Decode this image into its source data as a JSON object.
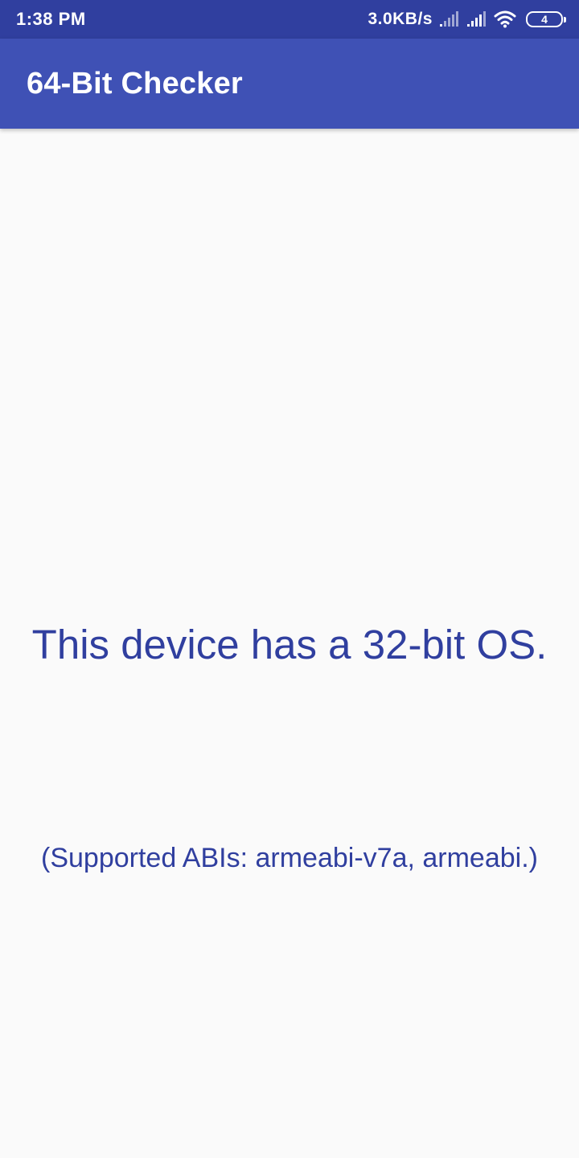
{
  "status_bar": {
    "time": "1:38 PM",
    "net_speed": "3.0KB/s",
    "battery_level": "4",
    "icons": [
      "signal-icon",
      "signal-icon",
      "wifi-icon",
      "battery-icon"
    ]
  },
  "app_bar": {
    "title": "64-Bit Checker"
  },
  "main": {
    "result": "This device has a 32-bit OS.",
    "abis": "(Supported ABIs: armeabi-v7a, armeabi.)"
  },
  "colors": {
    "status_bar": "#303f9f",
    "app_bar": "#3f51b5",
    "text": "#303f9f",
    "background": "#fafafa"
  }
}
